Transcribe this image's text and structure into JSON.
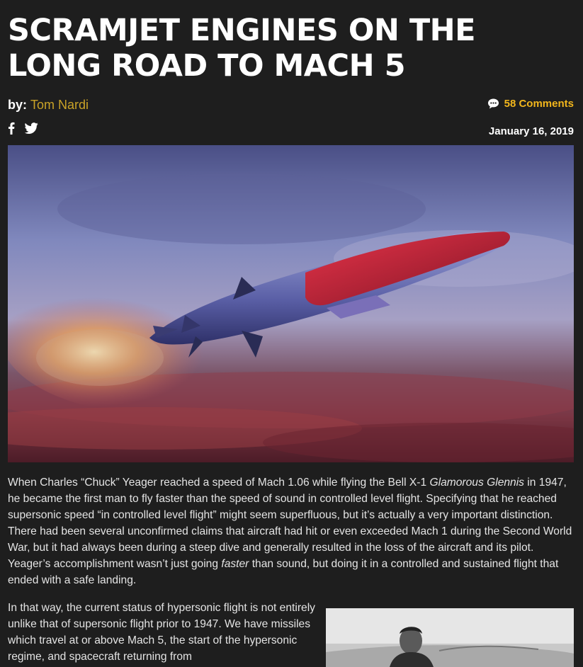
{
  "article": {
    "title": "SCRAMJET ENGINES ON THE LONG ROAD TO MACH 5",
    "byline_prefix": "by:",
    "author": "Tom Nardi",
    "comments": "58 Comments",
    "date": "January 16, 2019"
  },
  "icons": {
    "comments": "speech-bubble-icon",
    "facebook": "facebook-icon",
    "twitter": "twitter-icon"
  },
  "colors": {
    "background": "#1e1e1e",
    "author_link": "#c9a227",
    "comments_link": "#f2b61c",
    "text": "#e4e4e4"
  },
  "paragraph1": {
    "s1": "When Charles “Chuck” Yeager reached a speed of Mach 1.06 while flying the Bell X-1 ",
    "italic1": "Glamorous Glennis",
    "s2": " in 1947, he became the first man to fly faster than the speed of sound in controlled level flight. Specifying that he reached supersonic speed “in controlled level flight” might seem superfluous, but it’s actually a very important distinction. There had been several unconfirmed claims that aircraft had hit or even exceeded Mach 1 during the Second World War, but it had always been during a steep dive and generally resulted in the loss of the aircraft and its pilot. Yeager’s accomplishment wasn’t just going ",
    "italic2": "faster",
    "s3": " than sound, but doing it in a controlled and sustained flight that ended with a safe landing."
  },
  "paragraph2": {
    "text": "In that way, the current status of hypersonic flight is not entirely unlike that of supersonic flight prior to 1947. We have missiles which travel at or above Mach 5, the start of the hypersonic regime, and spacecraft returning from"
  }
}
